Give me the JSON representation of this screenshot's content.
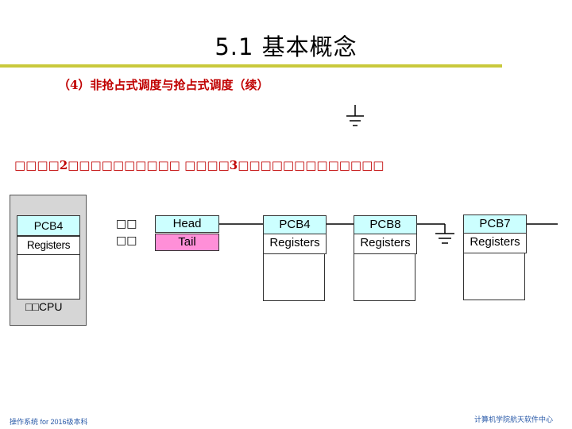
{
  "slide": {
    "title": "5.1 基本概念",
    "subtitle": "（4）非抢占式调度与抢占式调度（续）",
    "caption": "□□□□2□□□□□□□□□□ □□□□3□□□□□□□□□□□□□"
  },
  "cpu": {
    "pcb_label": "PCB4",
    "registers_label": "Registers",
    "cpu_label": "□□CPU"
  },
  "queue": {
    "label_line1": "□□",
    "label_line2": "□□",
    "head_label": "Head",
    "tail_label": "Tail",
    "nodes": [
      {
        "pcb": "PCB4",
        "registers": "Registers"
      },
      {
        "pcb": "PCB8",
        "registers": "Registers"
      },
      {
        "pcb": "PCB7",
        "registers": "Registers"
      }
    ]
  },
  "footer": {
    "left": "操作系统 for 2016级本科",
    "right": "计算机学院航天软件中心"
  },
  "colors": {
    "title_rule": "#c9c93c",
    "subtitle": "#c00000",
    "pcb_fill": "#ccffff",
    "tail_fill": "#ff8fd8",
    "cpu_fill": "#d6d6d6",
    "footer": "#2a5aa8"
  }
}
